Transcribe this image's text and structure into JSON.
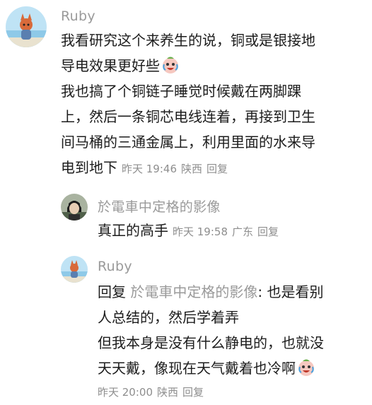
{
  "comments": [
    {
      "author": "Ruby",
      "lines": [
        "我看研究这个来养生的说，铜或是银接地",
        "导电效果更好些",
        "我也搞了个铜链子睡觉时候戴在两脚踝",
        "上，然后一条铜芯电线连着，再接到卫生",
        "间马桶的三通金属上，利用里面的水来导",
        "电到地下"
      ],
      "time": "昨天 19:46",
      "location": "陕西",
      "reply_label": "回复",
      "emoji": "crying-laughing-face-icon"
    },
    {
      "author": "於電車中定格的影像",
      "lines": [
        "真正的高手"
      ],
      "time": "昨天 19:58",
      "location": "广东",
      "reply_label": "回复"
    },
    {
      "author": "Ruby",
      "reply_prefix": "回复",
      "reply_to": "於電車中定格的影像",
      "lines": [
        ": 也是看别",
        "人总结的，然后学着弄",
        "但我本身是没有什么静电的，也就没",
        "天天戴，像现在天气戴着也冷啊"
      ],
      "time": "昨天 20:00",
      "location": "陕西",
      "reply_label": "回复",
      "emoji": "crying-laughing-face-icon"
    }
  ]
}
